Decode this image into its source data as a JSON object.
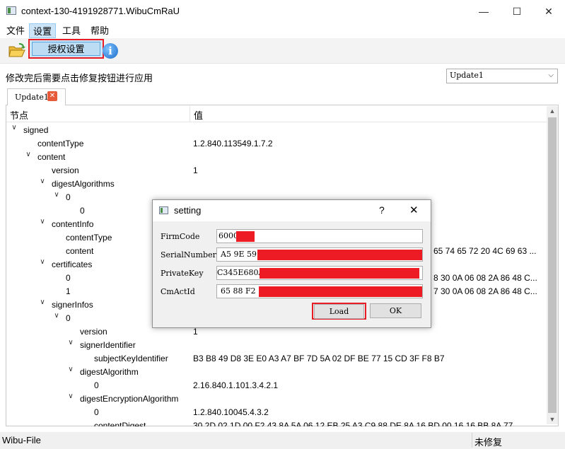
{
  "window": {
    "title": "context-130-4191928771.WibuCmRaU",
    "min_glyph": "—",
    "max_glyph": "☐",
    "close_glyph": "✕"
  },
  "menu": {
    "file": "文件",
    "settings": "设置",
    "tools": "工具",
    "help": "帮助"
  },
  "toolbar": {
    "auth_button": "授权设置",
    "info_glyph": "i"
  },
  "hint": "修改完后需要点击修复按钮进行应用",
  "combo": {
    "value": "Update1",
    "arrow": "⌵"
  },
  "tab": {
    "label": "Update1",
    "close_glyph": "✕"
  },
  "tree": {
    "headers": {
      "node": "节点",
      "value": "值"
    },
    "rows": [
      {
        "name": "signed",
        "value": "",
        "expanded": true
      },
      {
        "name": "contentType",
        "value": "1.2.840.113549.1.7.2",
        "expanded": null
      },
      {
        "name": "content",
        "value": "",
        "expanded": true
      },
      {
        "name": "version",
        "value": "1",
        "expanded": null
      },
      {
        "name": "digestAlgorithms",
        "value": "",
        "expanded": true
      },
      {
        "name": "0",
        "value": "",
        "expanded": true
      },
      {
        "name": "0",
        "value": "",
        "expanded": null
      },
      {
        "name": "contentInfo",
        "value": "",
        "expanded": true
      },
      {
        "name": "contentType",
        "value": "",
        "expanded": null
      },
      {
        "name": "content",
        "value": "65 74 65 72 20 4C 69 63 ...",
        "expanded": null
      },
      {
        "name": "certificates",
        "value": "",
        "expanded": true
      },
      {
        "name": "0",
        "value": "8 30 0A 06 08 2A 86 48 C...",
        "expanded": null
      },
      {
        "name": "1",
        "value": "7 30 0A 06 08 2A 86 48 C...",
        "expanded": null
      },
      {
        "name": "signerInfos",
        "value": "",
        "expanded": true
      },
      {
        "name": "0",
        "value": "",
        "expanded": true
      },
      {
        "name": "version",
        "value": "1",
        "expanded": null
      },
      {
        "name": "signerIdentifier",
        "value": "",
        "expanded": true
      },
      {
        "name": "subjectKeyIdentifier",
        "value": "B3 B8 49 D8 3E E0 A3 A7 BF 7D 5A 02 DF BE 77 15 CD 3F F8 B7",
        "expanded": null
      },
      {
        "name": "digestAlgorithm",
        "value": "",
        "expanded": true
      },
      {
        "name": "0",
        "value": "2.16.840.1.101.3.4.2.1",
        "expanded": null
      },
      {
        "name": "digestEncryptionAlgorithm",
        "value": "",
        "expanded": true
      },
      {
        "name": "0",
        "value": "1.2.840.10045.4.3.2",
        "expanded": null
      },
      {
        "name": "contentDigest",
        "value": "30 2D 02 1D 00 F2 43 8A 5A 06 12 EB 25 A3 C9 88 DE 8A 16 BD 00 16 16 BB 8A 77",
        "expanded": null
      }
    ]
  },
  "dialog": {
    "title": "setting",
    "help_glyph": "?",
    "close_glyph": "✕",
    "fields": [
      {
        "label": "FirmCode",
        "value": "6000"
      },
      {
        "label": "SerialNumber",
        "value": "A5 9E 59"
      },
      {
        "label": "PrivateKey",
        "value": "C345E680A7"
      },
      {
        "label": "CmActId",
        "value": "65 88 F2"
      }
    ],
    "load_label": "Load",
    "ok_label": "OK"
  },
  "status": {
    "left": "Wibu-File",
    "right": "未修复"
  },
  "colors": {
    "redaction": "#ed1c24",
    "highlight_border": "#e81c24",
    "menu_active": "#cce4f7"
  }
}
